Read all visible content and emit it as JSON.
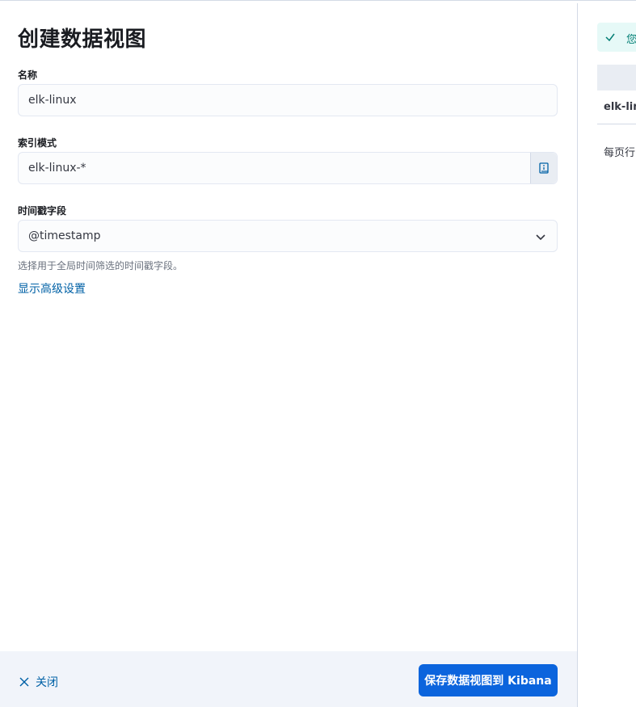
{
  "flyout": {
    "title": "创建数据视图",
    "name_field": {
      "label": "名称",
      "value": "elk-linux"
    },
    "pattern_field": {
      "label": "索引模式",
      "value": "elk-linux-*",
      "append_icon": "info-book-icon"
    },
    "timestamp_field": {
      "label": "时间戳字段",
      "value": "@timestamp",
      "help": "选择用于全局时间筛选的时间戳字段。"
    },
    "advanced_link": "显示高级设置",
    "footer": {
      "close_label": "关闭",
      "save_label": "保存数据视图到 Kibana"
    }
  },
  "preview": {
    "callout_text": "您",
    "row_text": "elk-lin",
    "rows_per_page": "每页行"
  },
  "colors": {
    "primary": "#0b64dd",
    "link": "#0061a6",
    "success": "#017d73"
  }
}
